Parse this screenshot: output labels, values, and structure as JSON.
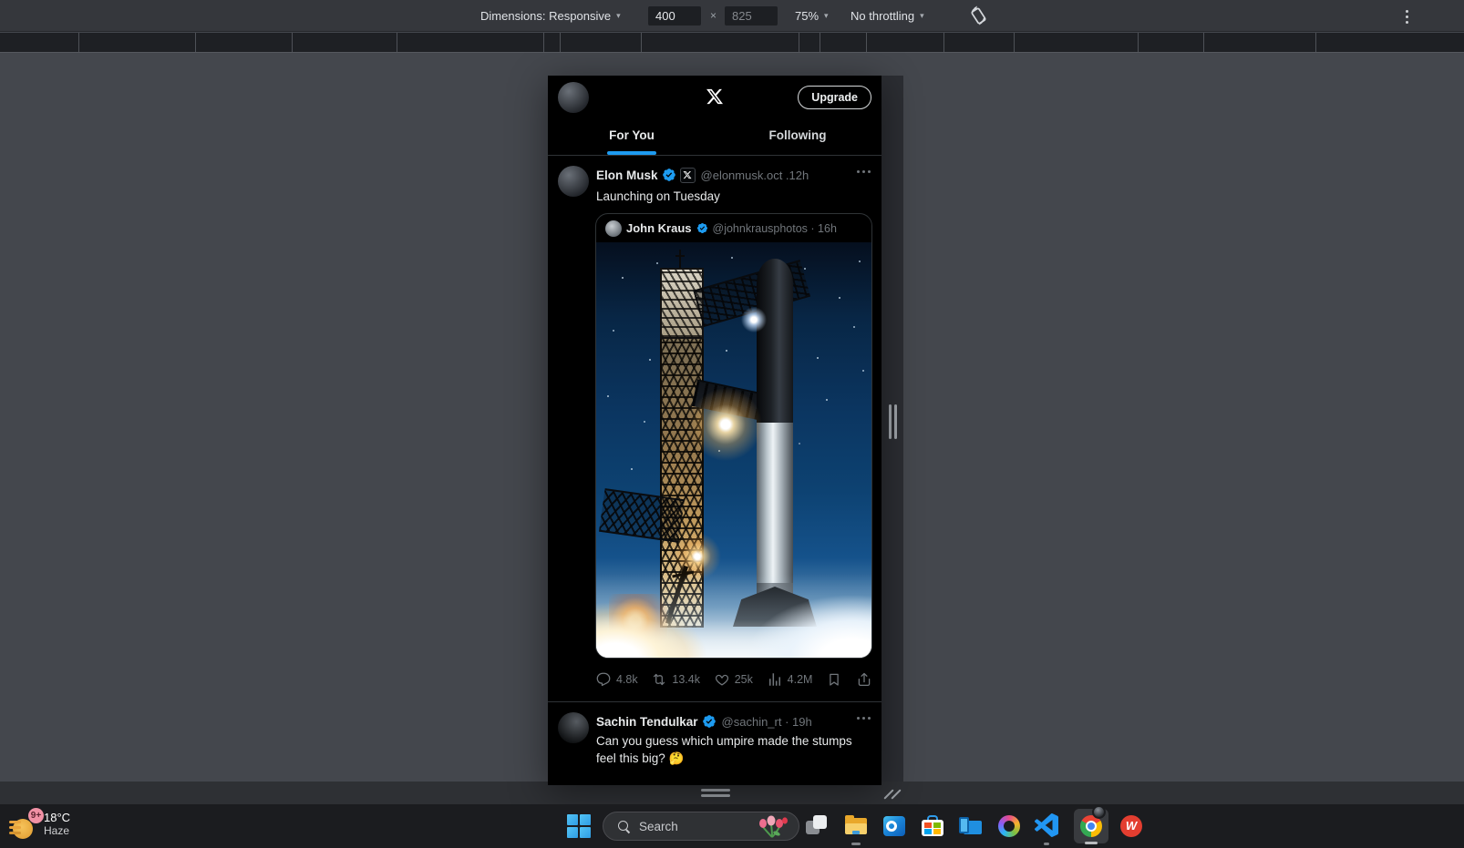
{
  "devtools_toolbar": {
    "dimensions_label": "Dimensions: Responsive",
    "width_value": "400",
    "multiply_sign": "×",
    "height_value": "825",
    "zoom_value": "75%",
    "throttling_value": "No throttling"
  },
  "phone": {
    "header": {
      "upgrade_label": "Upgrade"
    },
    "tabs": {
      "for_you": "For You",
      "following": "Following"
    },
    "tweets": [
      {
        "author": "Elon Musk",
        "handle": "@elonmusk.oct .12h",
        "text": "Launching on Tuesday",
        "quoted": {
          "author": "John Kraus",
          "handle": "@johnkrausphotos · 16h"
        },
        "stats": {
          "replies": "4.8k",
          "reposts": "13.4k",
          "likes": "25k",
          "views": "4.2M"
        }
      },
      {
        "author": "Sachin Tendulkar",
        "handle": "@sachin_rt · 19h",
        "text": "Can you guess which umpire made the stumps feel this big? 🤔"
      }
    ]
  },
  "taskbar": {
    "weather_temp": "18°C",
    "weather_condition": "Haze",
    "weather_badge": "9+",
    "search_label": "Search"
  },
  "colors": {
    "accent_blue": "#1d9bf0",
    "muted_gray": "#71767b",
    "toolbar_bg": "#35373c",
    "canvas_bg": "#44474d",
    "taskbar_bg": "#1b1c1f"
  }
}
